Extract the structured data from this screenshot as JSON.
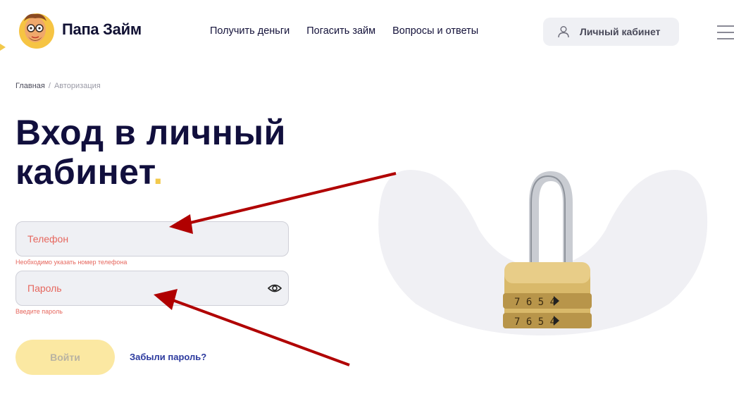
{
  "header": {
    "logo_text": "Папа Займ",
    "nav": [
      {
        "label": "Получить деньги"
      },
      {
        "label": "Погасить займ"
      },
      {
        "label": "Вопросы и ответы"
      }
    ],
    "account_label": "Личный кабинет"
  },
  "breadcrumb": {
    "home": "Главная",
    "separator": "/",
    "current": "Авторизация"
  },
  "page": {
    "title_line1": "Вход в личный",
    "title_line2": "кабинет",
    "title_dot": "."
  },
  "form": {
    "phone_placeholder": "Телефон",
    "phone_error": "Необходимо указать номер телефона",
    "password_placeholder": "Пароль",
    "password_error": "Введите пароль",
    "login_label": "Войти",
    "forgot_label": "Забыли пароль?"
  },
  "colors": {
    "accent_yellow": "#f2c94c",
    "error_red": "#e6675e",
    "link_blue": "#2c3a9e",
    "annotation_arrow": "#b00000"
  },
  "icons": [
    "logo-face-icon",
    "user-icon",
    "menu-icon",
    "eye-icon",
    "padlock-image"
  ]
}
